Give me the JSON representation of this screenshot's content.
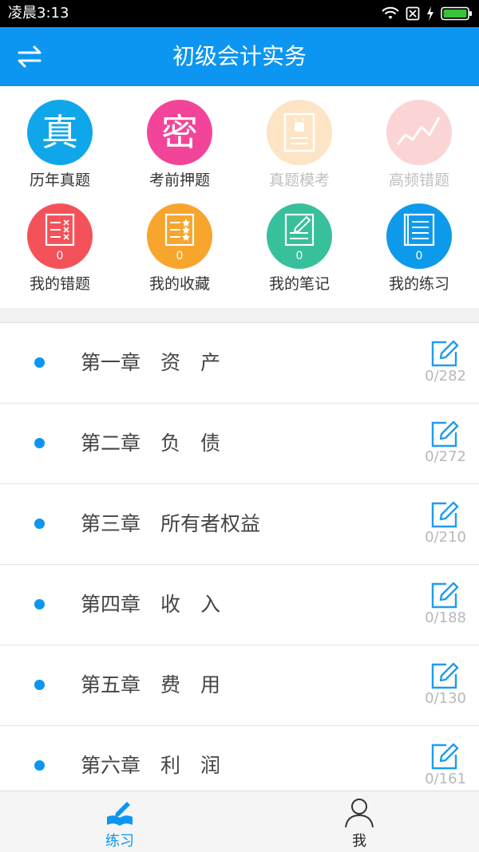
{
  "status_bar": {
    "time": "凌晨3:13",
    "battery_color": "#39c23a"
  },
  "app_bar": {
    "title": "初级会计实务",
    "color": "#0c96f2",
    "swap_icon": "swap-arrows-icon"
  },
  "menu": [
    {
      "label": "历年真题",
      "glyph": "真",
      "color": "#10a7ea",
      "enabled": true,
      "icon": "zhen-glyph-icon"
    },
    {
      "label": "考前押题",
      "glyph": "密",
      "color": "#f2459a",
      "enabled": true,
      "icon": "mi-glyph-icon"
    },
    {
      "label": "真题模考",
      "color": "#fde4c4",
      "enabled": false,
      "icon": "mock-exam-icon"
    },
    {
      "label": "高频错题",
      "color": "#fbd5d5",
      "enabled": false,
      "icon": "trend-chart-icon"
    },
    {
      "label": "我的错题",
      "count": "0",
      "color": "#f4525a",
      "icon": "wrong-list-icon"
    },
    {
      "label": "我的收藏",
      "count": "0",
      "color": "#f7a52c",
      "icon": "star-list-icon"
    },
    {
      "label": "我的笔记",
      "count": "0",
      "color": "#38bf9b",
      "icon": "note-pencil-icon"
    },
    {
      "label": "我的练习",
      "count": "0",
      "color": "#0e9aea",
      "icon": "practice-book-icon"
    }
  ],
  "chapters": [
    {
      "title": "第一章　资　产",
      "progress": "0/282"
    },
    {
      "title": "第二章　负　债",
      "progress": "0/272"
    },
    {
      "title": "第三章　所有者权益",
      "progress": "0/210"
    },
    {
      "title": "第四章　收　入",
      "progress": "0/188"
    },
    {
      "title": "第五章　费　用",
      "progress": "0/130"
    },
    {
      "title": "第六章　利　润",
      "progress": "0/161"
    }
  ],
  "tabs": [
    {
      "label": "练习",
      "active": true,
      "icon": "practice-pen-icon",
      "color": "#0c96f2"
    },
    {
      "label": "我",
      "active": false,
      "icon": "person-outline-icon",
      "color": "#222222"
    }
  ]
}
